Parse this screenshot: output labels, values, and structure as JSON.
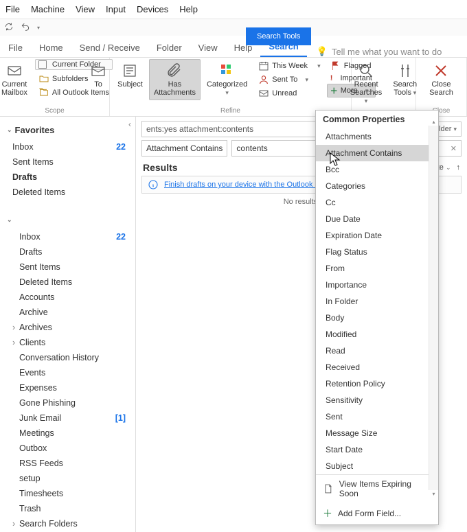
{
  "menu": {
    "file": "File",
    "machine": "Machine",
    "view": "View",
    "input": "Input",
    "devices": "Devices",
    "help": "Help"
  },
  "toolstab": "Search Tools",
  "tabs": {
    "file": "File",
    "home": "Home",
    "send": "Send / Receive",
    "folder": "Folder",
    "view": "View",
    "help": "Help",
    "search": "Search"
  },
  "tellme": "Tell me what you want to do",
  "ribbon": {
    "scope": {
      "label": "Scope",
      "current_mailbox": "Current\nMailbox",
      "current_folder": "Current Folder",
      "subfolders": "Subfolders",
      "all_items": "All Outlook Items"
    },
    "refine": {
      "label": "Refine",
      "to": "To",
      "subject": "Subject",
      "has_attachments": "Has\nAttachments",
      "categorized": "Categorized",
      "this_week": "This Week",
      "sent_to": "Sent To",
      "unread": "Unread",
      "flagged": "Flagged",
      "important": "Important",
      "more": "More"
    },
    "options": {
      "recent": "Recent\nSearches",
      "tools": "Search\nTools"
    },
    "close": {
      "label": "Close",
      "btn": "Close\nSearch"
    }
  },
  "search": {
    "query": "ents:yes attachment:contents",
    "scope": "Current Folder",
    "filter_label": "Attachment Contains",
    "filter_value": "contents"
  },
  "results": {
    "title": "Results",
    "sort": "By Date",
    "infobar": "Finish drafts on your device with the Outlook app",
    "none": "No results."
  },
  "nav": {
    "favorites": "Favorites",
    "fav_items": [
      {
        "label": "Inbox",
        "count": "22"
      },
      {
        "label": "Sent Items"
      },
      {
        "label": "Drafts",
        "selected": true
      },
      {
        "label": "Deleted Items"
      }
    ],
    "folders": [
      {
        "label": "Inbox",
        "count": "22"
      },
      {
        "label": "Drafts"
      },
      {
        "label": "Sent Items"
      },
      {
        "label": "Deleted Items"
      },
      {
        "label": "Accounts"
      },
      {
        "label": "Archive"
      },
      {
        "label": "Archives",
        "expandable": true
      },
      {
        "label": "Clients",
        "expandable": true
      },
      {
        "label": "Conversation History"
      },
      {
        "label": "Events"
      },
      {
        "label": "Expenses"
      },
      {
        "label": "Gone Phishing"
      },
      {
        "label": "Junk Email",
        "count": "[1]"
      },
      {
        "label": "Meetings"
      },
      {
        "label": "Outbox"
      },
      {
        "label": "RSS Feeds"
      },
      {
        "label": "setup"
      },
      {
        "label": "Timesheets"
      },
      {
        "label": "Trash"
      },
      {
        "label": "Search Folders",
        "expandable": true
      }
    ]
  },
  "popup": {
    "header": "Common Properties",
    "highlight": "Attachment Contains",
    "items": [
      "Attachments",
      "Attachment Contains",
      "Bcc",
      "Categories",
      "Cc",
      "Due Date",
      "Expiration Date",
      "Flag Status",
      "From",
      "Importance",
      "In Folder",
      "Body",
      "Modified",
      "Read",
      "Received",
      "Retention Policy",
      "Sensitivity",
      "Sent",
      "Message Size",
      "Start Date",
      "Subject"
    ],
    "view_expiring": "View Items Expiring Soon",
    "add_field": "Add Form Field..."
  }
}
